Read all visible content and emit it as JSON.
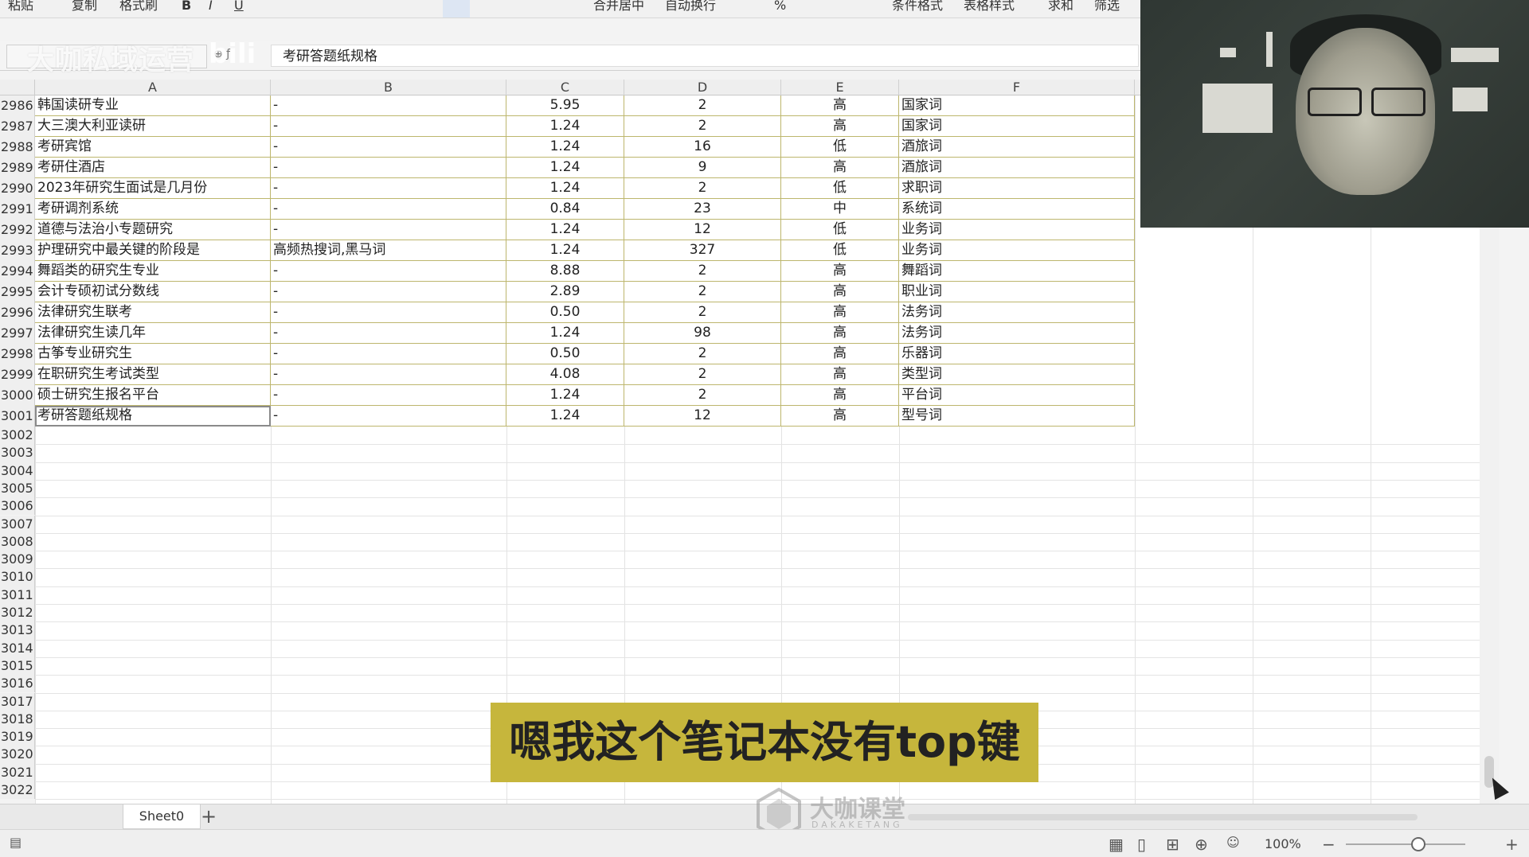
{
  "toolbar": {
    "items": [
      "粘贴",
      "复制",
      "格式刷",
      "B",
      "I",
      "U",
      "合并居中",
      "自动换行",
      "%",
      "条件格式",
      "表格样式",
      "求和",
      "筛选"
    ]
  },
  "watermark": {
    "channel": "大咖私域运营",
    "site": "bili"
  },
  "formula_bar": {
    "content": "考研答题纸规格"
  },
  "columns": [
    "A",
    "B",
    "C",
    "D",
    "E",
    "F"
  ],
  "rows": [
    {
      "num": "2986",
      "a": "韩国读研专业",
      "b": "-",
      "c": "5.95",
      "d": "2",
      "e": "高",
      "f": "国家词"
    },
    {
      "num": "2987",
      "a": "大三澳大利亚读研",
      "b": "-",
      "c": "1.24",
      "d": "2",
      "e": "高",
      "f": "国家词"
    },
    {
      "num": "2988",
      "a": "考研宾馆",
      "b": "-",
      "c": "1.24",
      "d": "16",
      "e": "低",
      "f": "酒旅词"
    },
    {
      "num": "2989",
      "a": "考研住酒店",
      "b": "-",
      "c": "1.24",
      "d": "9",
      "e": "高",
      "f": "酒旅词"
    },
    {
      "num": "2990",
      "a": "2023年研究生面试是几月份",
      "b": "-",
      "c": "1.24",
      "d": "2",
      "e": "低",
      "f": "求职词"
    },
    {
      "num": "2991",
      "a": "考研调剂系统",
      "b": "-",
      "c": "0.84",
      "d": "23",
      "e": "中",
      "f": "系统词"
    },
    {
      "num": "2992",
      "a": "道德与法治小专题研究",
      "b": "-",
      "c": "1.24",
      "d": "12",
      "e": "低",
      "f": "业务词"
    },
    {
      "num": "2993",
      "a": "护理研究中最关键的阶段是",
      "b": "高频热搜词,黑马词",
      "c": "1.24",
      "d": "327",
      "e": "低",
      "f": "业务词"
    },
    {
      "num": "2994",
      "a": "舞蹈类的研究生专业",
      "b": "-",
      "c": "8.88",
      "d": "2",
      "e": "高",
      "f": "舞蹈词"
    },
    {
      "num": "2995",
      "a": "会计专硕初试分数线",
      "b": "-",
      "c": "2.89",
      "d": "2",
      "e": "高",
      "f": "职业词"
    },
    {
      "num": "2996",
      "a": "法律研究生联考",
      "b": "-",
      "c": "0.50",
      "d": "2",
      "e": "高",
      "f": "法务词"
    },
    {
      "num": "2997",
      "a": "法律研究生读几年",
      "b": "-",
      "c": "1.24",
      "d": "98",
      "e": "高",
      "f": "法务词"
    },
    {
      "num": "2998",
      "a": "古筝专业研究生",
      "b": "-",
      "c": "0.50",
      "d": "2",
      "e": "高",
      "f": "乐器词"
    },
    {
      "num": "2999",
      "a": "在职研究生考试类型",
      "b": "-",
      "c": "4.08",
      "d": "2",
      "e": "高",
      "f": "类型词"
    },
    {
      "num": "3000",
      "a": "硕士研究生报名平台",
      "b": "-",
      "c": "1.24",
      "d": "2",
      "e": "高",
      "f": "平台词"
    },
    {
      "num": "3001",
      "a": "考研答题纸规格",
      "b": "-",
      "c": "1.24",
      "d": "12",
      "e": "高",
      "f": "型号词"
    }
  ],
  "empty_rows": [
    "3002",
    "3003",
    "3004",
    "3005",
    "3006",
    "3007",
    "3008",
    "3009",
    "3010",
    "3011",
    "3012",
    "3013",
    "3014",
    "3015",
    "3016",
    "3017",
    "3018",
    "3019",
    "3020",
    "3021",
    "3022"
  ],
  "subtitle": "嗯我这个笔记本没有top键",
  "sheet_tab": "Sheet0",
  "add_sheet": "+",
  "logo": {
    "name": "大咖课堂",
    "sub": "DAKAKETANG"
  },
  "status": {
    "zoom": "100%"
  }
}
